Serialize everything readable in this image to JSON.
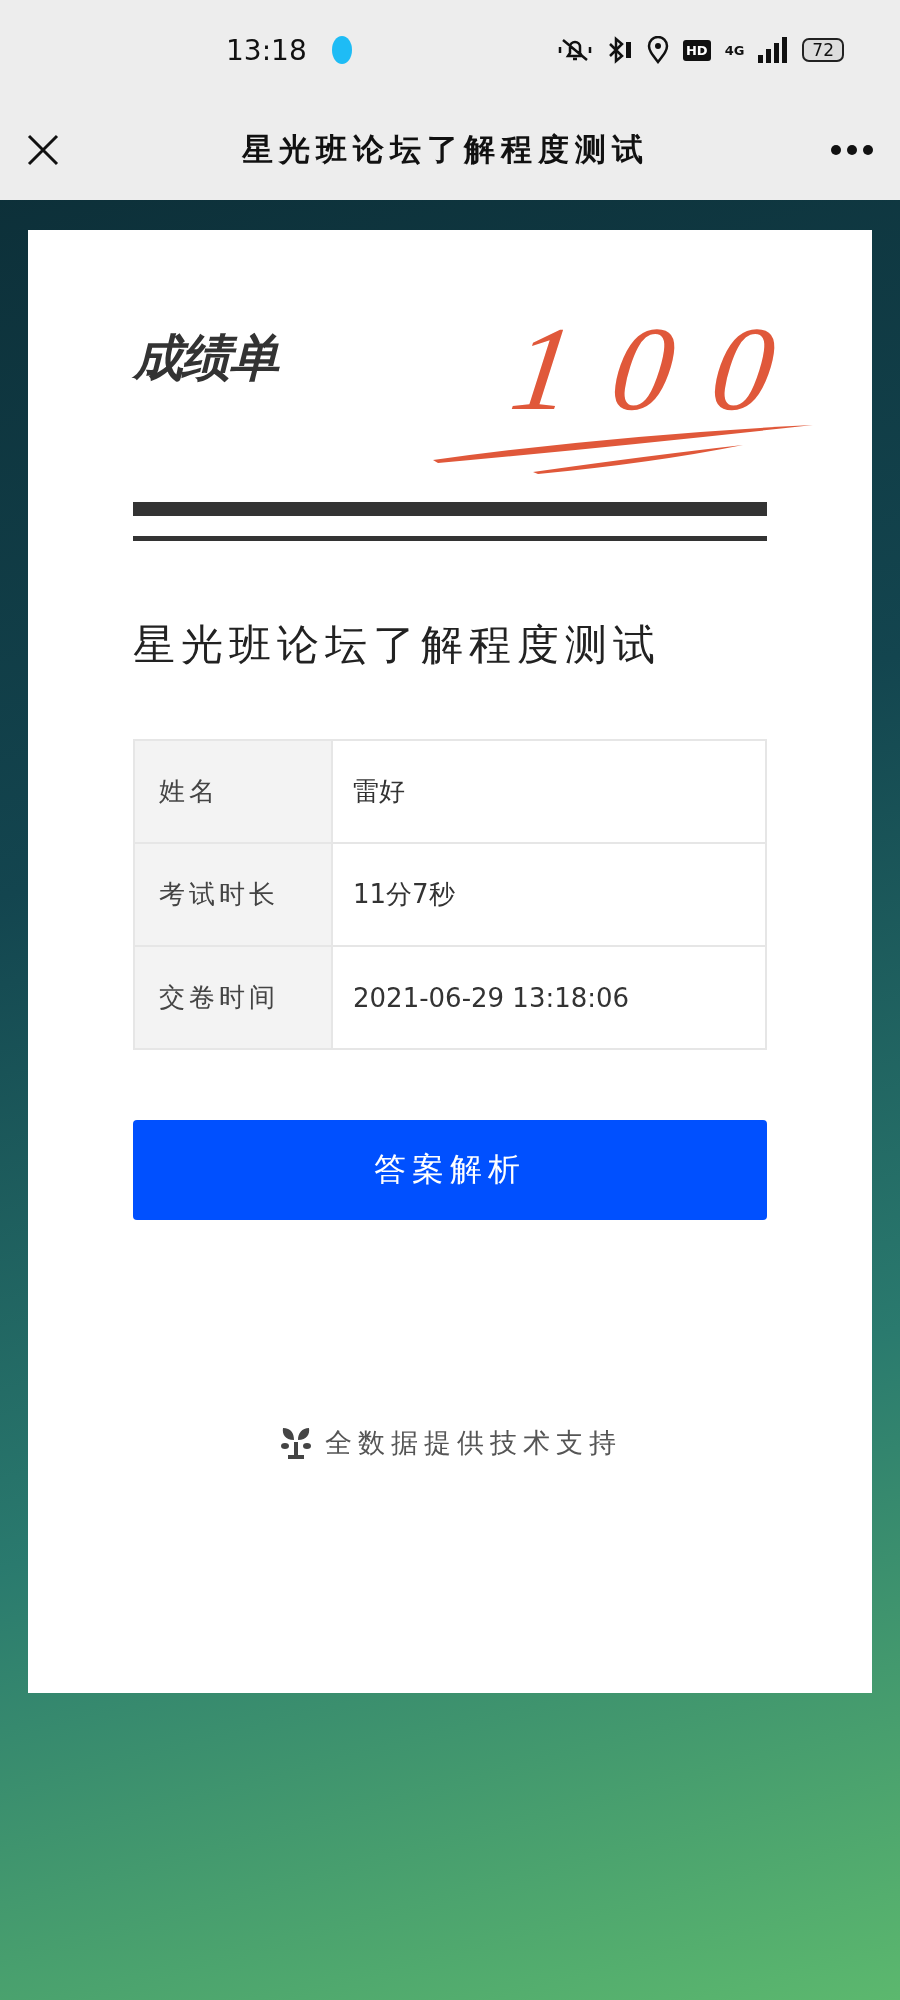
{
  "status_bar": {
    "time": "13:18",
    "battery": "72",
    "network": "4G",
    "hd": "HD"
  },
  "nav": {
    "title": "星光班论坛了解程度测试"
  },
  "card": {
    "heading": "成绩单",
    "score": "100",
    "quiz_title": "星光班论坛了解程度测试",
    "rows": [
      {
        "label": "姓名",
        "value": "雷好"
      },
      {
        "label": "考试时长",
        "value": "11分7秒"
      },
      {
        "label": "交卷时间",
        "value": "2021-06-29 13:18:06"
      }
    ],
    "button": "答案解析",
    "footer": "全数据提供技术支持"
  }
}
